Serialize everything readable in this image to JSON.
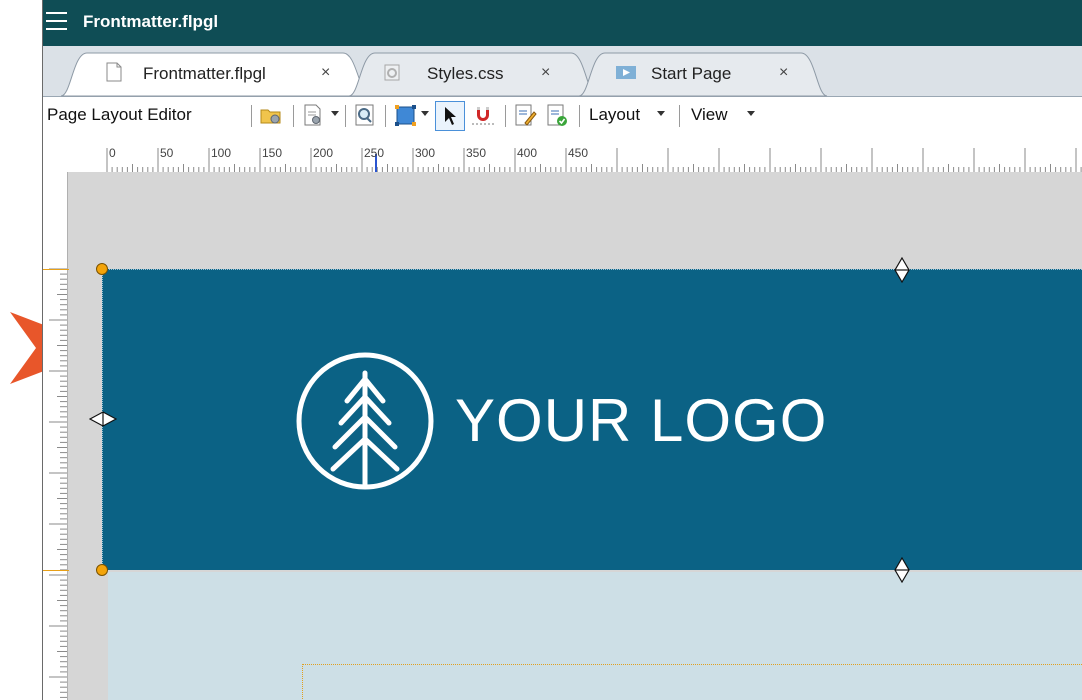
{
  "app": {
    "title": "Frontmatter.flpgl",
    "menu_icon": "hamburger-menu-icon"
  },
  "tabs": [
    {
      "label": "Frontmatter.flpgl",
      "close": "×",
      "active": true,
      "icon": "document-icon"
    },
    {
      "label": "Styles.css",
      "close": "×",
      "active": false,
      "icon": "stylesheet-icon"
    },
    {
      "label": "Start Page",
      "close": "×",
      "active": false,
      "icon": "start-page-icon"
    }
  ],
  "toolbar": {
    "editor_label": "Page Layout Editor",
    "layout_menu": "Layout",
    "view_menu": "View",
    "icons": [
      "open-page-icon",
      "page-properties-icon",
      "zoom-icon",
      "insert-frame-icon",
      "select-pointer-icon",
      "snap-magnet-icon",
      "edit-page-icon",
      "approve-page-icon"
    ]
  },
  "ruler": {
    "labels": [
      "0",
      "50",
      "100",
      "150",
      "200",
      "250",
      "300",
      "350",
      "400",
      "450"
    ]
  },
  "banner": {
    "logo_text": "YOUR LOGO",
    "color": "#0b6285"
  },
  "colors": {
    "titlebar": "#0f4d55",
    "handle": "#f3a40a",
    "pointer_arrow": "#e8562a",
    "lower_panel": "#cddfe6"
  }
}
